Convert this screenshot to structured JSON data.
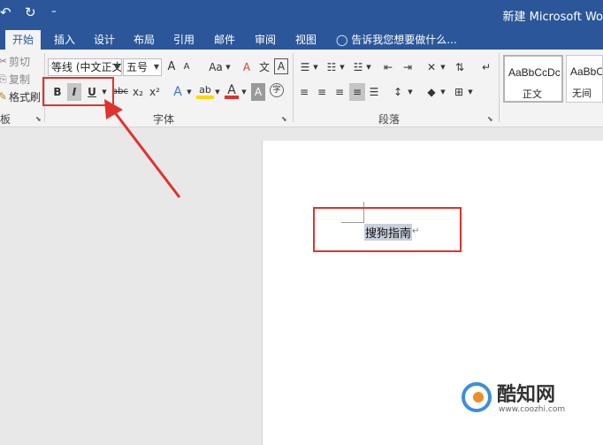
{
  "quick_access": {
    "undo_icon": "↶",
    "redo_icon": "↻",
    "customize_icon": "⁼"
  },
  "window": {
    "title": "新建 Microsoft Wo"
  },
  "tabs": [
    "开始",
    "插入",
    "设计",
    "布局",
    "引用",
    "邮件",
    "审阅",
    "视图"
  ],
  "tell_me": {
    "icon": "lightbulb-icon",
    "text": "告诉我您想要做什么..."
  },
  "clipboard": {
    "cut": "剪切",
    "copy": "复制",
    "format_painter": "格式刷",
    "group_label": "板"
  },
  "font": {
    "font_name": "等线 (中文正文",
    "font_size": "五号",
    "grow": "A",
    "shrink": "A",
    "change_case": "Aa",
    "bold": "B",
    "italic": "I",
    "underline": "U",
    "strikethrough": "abc",
    "subscript": "x₂",
    "superscript": "x²",
    "text_effects": "A",
    "highlight": "ab",
    "font_color": "A",
    "char_shading": "A",
    "enclose": "字",
    "group_label": "字体"
  },
  "paragraph": {
    "group_label": "段落"
  },
  "styles": [
    {
      "sample": "AaBbCcDc",
      "name": "正文"
    },
    {
      "sample": "AaBbC",
      "name": "无间"
    }
  ],
  "document": {
    "text": "搜狗指南",
    "para_mark": "↵"
  },
  "watermark": {
    "name": "酷知网",
    "url": "www.coozhi.com"
  },
  "colors": {
    "title_bar": "#2b579a",
    "annotation": "#e0322d",
    "highlight_yellow": "#ffd700",
    "font_red": "#e0322d"
  }
}
